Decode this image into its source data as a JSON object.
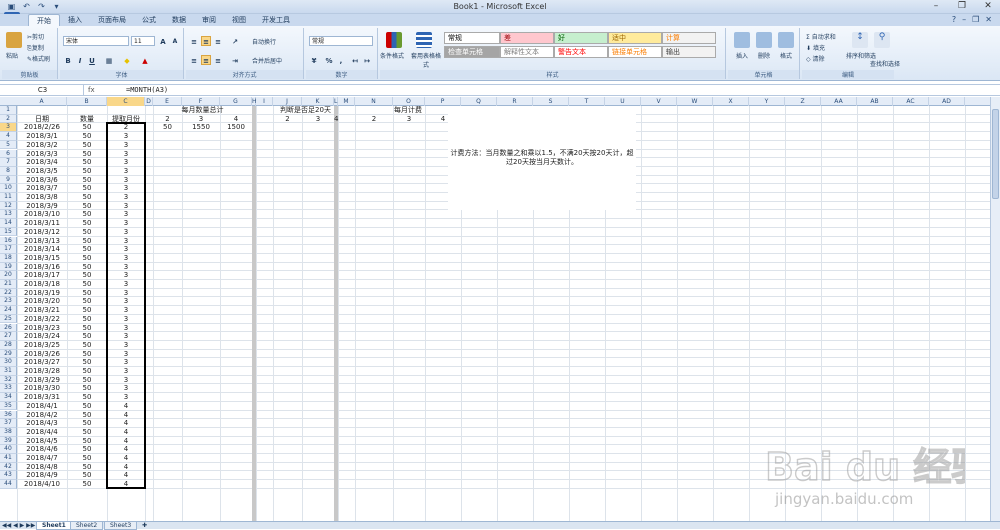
{
  "window": {
    "title": "Book1 - Microsoft Excel"
  },
  "tabs": [
    "开始",
    "插入",
    "页面布局",
    "公式",
    "数据",
    "审阅",
    "视图",
    "开发工具"
  ],
  "active_tab": 0,
  "ribbon": {
    "clipboard": {
      "cut": "剪切",
      "copy": "复制",
      "format_painter": "格式刷",
      "paste": "粘贴",
      "label": "剪贴板"
    },
    "font": {
      "name": "宋体",
      "size": "11",
      "label": "字体",
      "bold": "B",
      "italic": "I",
      "underline": "U",
      "grow": "A",
      "shrink": "A"
    },
    "alignment": {
      "wrap": "自动换行",
      "merge": "合并后居中",
      "label": "对齐方式"
    },
    "number": {
      "format": "常规",
      "label": "数字",
      "percent": "%",
      "comma": ","
    },
    "styles": {
      "label": "样式",
      "conditional": "条件格式",
      "table": "套用表格格式",
      "cells": [
        {
          "text": "常规",
          "bg": "#ffffff",
          "fg": "#000000"
        },
        {
          "text": "差",
          "bg": "#ffc7ce",
          "fg": "#9c0006"
        },
        {
          "text": "好",
          "bg": "#c6efce",
          "fg": "#006100"
        },
        {
          "text": "适中",
          "bg": "#ffeb9c",
          "fg": "#9c6500"
        },
        {
          "text": "计算",
          "bg": "#f2f2f2",
          "fg": "#fa7d00"
        },
        {
          "text": "检查单元格",
          "bg": "#a5a5a5",
          "fg": "#ffffff"
        },
        {
          "text": "解释性文本",
          "bg": "#ffffff",
          "fg": "#7f7f7f"
        },
        {
          "text": "警告文本",
          "bg": "#ffffff",
          "fg": "#ff0000"
        },
        {
          "text": "链接单元格",
          "bg": "#ffffff",
          "fg": "#fa7d00"
        },
        {
          "text": "输出",
          "bg": "#f2f2f2",
          "fg": "#3f3f3f"
        }
      ]
    },
    "cells_group": {
      "insert": "插入",
      "delete": "删除",
      "format": "格式",
      "label": "单元格"
    },
    "editing": {
      "autosum": "自动求和",
      "fill": "填充",
      "clear": "清除",
      "sort": "排序和筛选",
      "find": "查找和选择",
      "label": "编辑"
    }
  },
  "formula_bar": {
    "namebox": "C3",
    "fx": "fx",
    "formula": "=MONTH(A3)"
  },
  "columns": [
    "A",
    "B",
    "C",
    "D",
    "E",
    "F",
    "G",
    "H",
    "I",
    "J",
    "K",
    "L",
    "M",
    "N",
    "O",
    "P",
    "Q",
    "R",
    "S",
    "T",
    "U",
    "V",
    "W",
    "X",
    "Y",
    "Z",
    "AA",
    "AB",
    "AC",
    "AD"
  ],
  "selected_column": "C",
  "row_count": 44,
  "header_row": {
    "a": "日期",
    "b": "数量",
    "c": "提取月份"
  },
  "rows": [
    {
      "a": "2018/2/26",
      "b": "50",
      "c": "2"
    },
    {
      "a": "2018/3/1",
      "b": "50",
      "c": "3"
    },
    {
      "a": "2018/3/2",
      "b": "50",
      "c": "3"
    },
    {
      "a": "2018/3/3",
      "b": "50",
      "c": "3"
    },
    {
      "a": "2018/3/4",
      "b": "50",
      "c": "3"
    },
    {
      "a": "2018/3/5",
      "b": "50",
      "c": "3"
    },
    {
      "a": "2018/3/6",
      "b": "50",
      "c": "3"
    },
    {
      "a": "2018/3/7",
      "b": "50",
      "c": "3"
    },
    {
      "a": "2018/3/8",
      "b": "50",
      "c": "3"
    },
    {
      "a": "2018/3/9",
      "b": "50",
      "c": "3"
    },
    {
      "a": "2018/3/10",
      "b": "50",
      "c": "3"
    },
    {
      "a": "2018/3/11",
      "b": "50",
      "c": "3"
    },
    {
      "a": "2018/3/12",
      "b": "50",
      "c": "3"
    },
    {
      "a": "2018/3/13",
      "b": "50",
      "c": "3"
    },
    {
      "a": "2018/3/14",
      "b": "50",
      "c": "3"
    },
    {
      "a": "2018/3/15",
      "b": "50",
      "c": "3"
    },
    {
      "a": "2018/3/16",
      "b": "50",
      "c": "3"
    },
    {
      "a": "2018/3/17",
      "b": "50",
      "c": "3"
    },
    {
      "a": "2018/3/18",
      "b": "50",
      "c": "3"
    },
    {
      "a": "2018/3/19",
      "b": "50",
      "c": "3"
    },
    {
      "a": "2018/3/20",
      "b": "50",
      "c": "3"
    },
    {
      "a": "2018/3/21",
      "b": "50",
      "c": "3"
    },
    {
      "a": "2018/3/22",
      "b": "50",
      "c": "3"
    },
    {
      "a": "2018/3/23",
      "b": "50",
      "c": "3"
    },
    {
      "a": "2018/3/24",
      "b": "50",
      "c": "3"
    },
    {
      "a": "2018/3/25",
      "b": "50",
      "c": "3"
    },
    {
      "a": "2018/3/26",
      "b": "50",
      "c": "3"
    },
    {
      "a": "2018/3/27",
      "b": "50",
      "c": "3"
    },
    {
      "a": "2018/3/28",
      "b": "50",
      "c": "3"
    },
    {
      "a": "2018/3/29",
      "b": "50",
      "c": "3"
    },
    {
      "a": "2018/3/30",
      "b": "50",
      "c": "3"
    },
    {
      "a": "2018/3/31",
      "b": "50",
      "c": "3"
    },
    {
      "a": "2018/4/1",
      "b": "50",
      "c": "4"
    },
    {
      "a": "2018/4/2",
      "b": "50",
      "c": "4"
    },
    {
      "a": "2018/4/3",
      "b": "50",
      "c": "4"
    },
    {
      "a": "2018/4/4",
      "b": "50",
      "c": "4"
    },
    {
      "a": "2018/4/5",
      "b": "50",
      "c": "4"
    },
    {
      "a": "2018/4/6",
      "b": "50",
      "c": "4"
    },
    {
      "a": "2018/4/7",
      "b": "50",
      "c": "4"
    },
    {
      "a": "2018/4/8",
      "b": "50",
      "c": "4"
    },
    {
      "a": "2018/4/9",
      "b": "50",
      "c": "4"
    },
    {
      "a": "2018/4/10",
      "b": "50",
      "c": "4"
    }
  ],
  "monthly_total": {
    "title": "每月数量总计",
    "months": [
      "2",
      "3",
      "4"
    ],
    "values": [
      "50",
      "1550",
      "1500"
    ]
  },
  "over20": {
    "title": "判断是否足20天",
    "months": [
      "2",
      "3",
      "4"
    ]
  },
  "monthly_fee": {
    "title": "每月计费",
    "months": [
      "2",
      "3",
      "4"
    ]
  },
  "note": "计费方法：当月数量之和乘以1.5，不满20天按20天计，超过20天按当月天数计。",
  "sheets": [
    "Sheet1",
    "Sheet2",
    "Sheet3"
  ],
  "active_sheet": 0,
  "watermark": {
    "brand": "Bai du 经验",
    "url": "jingyan.baidu.com"
  }
}
